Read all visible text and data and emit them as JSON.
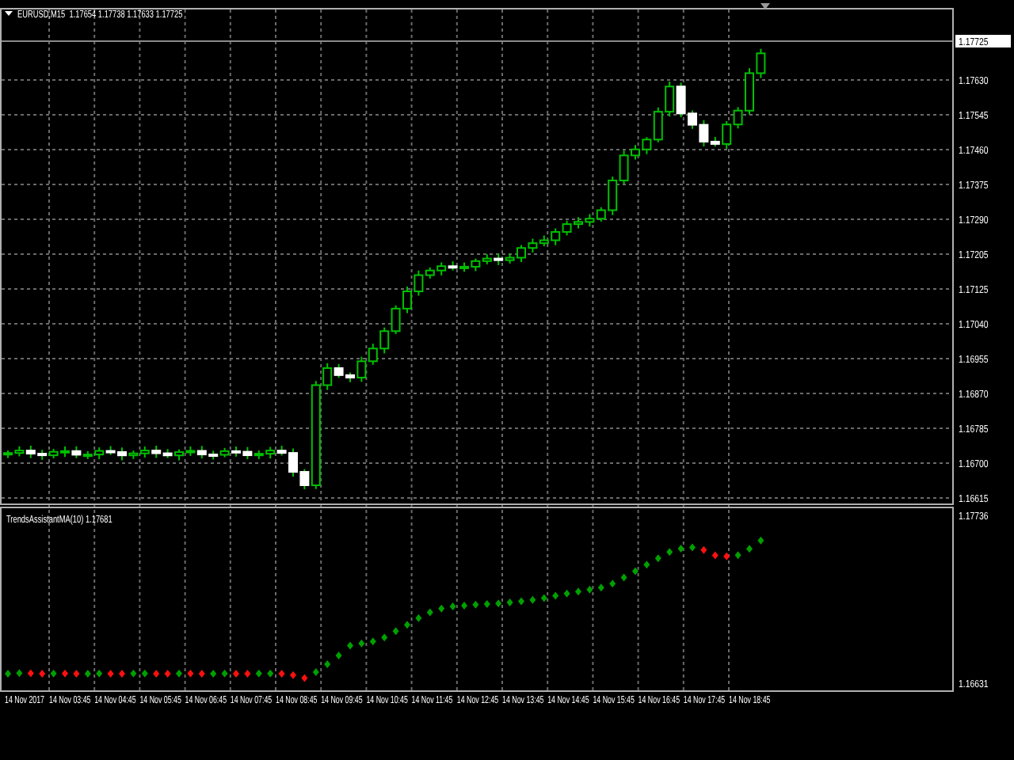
{
  "main_chart": {
    "title": "EURUSD,M15  1.17654 1.17738 1.17633 1.17725",
    "current_price": "1.17725",
    "price_labels": [
      "1.17630",
      "1.17545",
      "1.17460",
      "1.17375",
      "1.17290",
      "1.17205",
      "1.17125",
      "1.17040",
      "1.16955",
      "1.16870",
      "1.16785",
      "1.16700",
      "1.16615"
    ]
  },
  "indicator": {
    "title": "TrendsAssistantMA(10) 1.17681",
    "scale": [
      "1.17736",
      "1.16631"
    ]
  },
  "time_axis": {
    "labels": [
      "14 Nov 2017",
      "14 Nov 03:45",
      "14 Nov 04:45",
      "14 Nov 05:45",
      "14 Nov 06:45",
      "14 Nov 07:45",
      "14 Nov 08:45",
      "14 Nov 09:45",
      "14 Nov 10:45",
      "14 Nov 11:45",
      "14 Nov 12:45",
      "14 Nov 13:45",
      "14 Nov 14:45",
      "14 Nov 15:45",
      "14 Nov 16:45",
      "14 Nov 17:45",
      "14 Nov 18:45"
    ]
  }
}
